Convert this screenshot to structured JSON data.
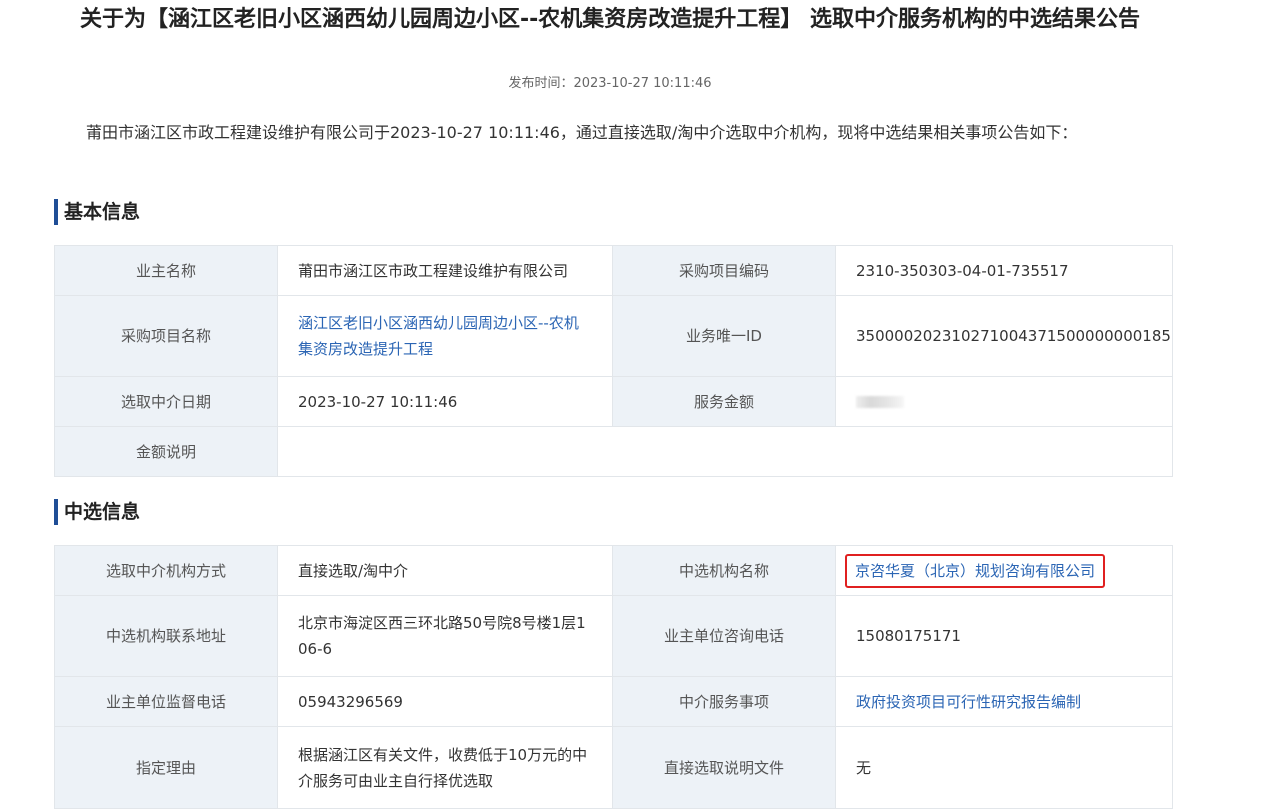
{
  "notice": {
    "title": "关于为【涵江区老旧小区涵西幼儿园周边小区--农机集资房改造提升工程】 选取中介服务机构的中选结果公告",
    "publish_time": "发布时间：2023-10-27 10:11:46",
    "intro": "莆田市涵江区市政工程建设维护有限公司于2023-10-27 10:11:46，通过直接选取/淘中介选取中介机构，现将中选结果相关事项公告如下："
  },
  "basic": {
    "heading": "基本信息",
    "owner_label": "业主名称",
    "owner_value": "莆田市涵江区市政工程建设维护有限公司",
    "proj_code_label": "采购项目编码",
    "proj_code_value": "2310-350303-04-01-735517",
    "proj_name_label": "采购项目名称",
    "proj_name_value": "涵江区老旧小区涵西幼儿园周边小区--农机集资房改造提升工程",
    "biz_id_label": "业务唯一ID",
    "biz_id_value": "350000202310271004371500000000185",
    "date_label": "选取中介日期",
    "date_value": "2023-10-27 10:11:46",
    "amount_label": "服务金额",
    "amount_note_label": "金额说明",
    "amount_note_value": ""
  },
  "selected": {
    "heading": "中选信息",
    "method_label": "选取中介机构方式",
    "method_value": "直接选取/淘中介",
    "org_label": "中选机构名称",
    "org_value": "京咨华夏（北京）规划咨询有限公司",
    "addr_label": "中选机构联系地址",
    "addr_value": "北京市海淀区西三环北路50号院8号楼1层106-6",
    "consult_phone_label": "业主单位咨询电话",
    "consult_phone_value": "15080175171",
    "supervise_phone_label": "业主单位监督电话",
    "supervise_phone_value": "05943296569",
    "service_label": "中介服务事项",
    "service_value": "政府投资项目可行性研究报告编制",
    "reason_label": "指定理由",
    "reason_value": "根据涵江区有关文件，收费低于10万元的中介服务可由业主自行择优选取",
    "direct_doc_label": "直接选取说明文件",
    "direct_doc_value": "无"
  }
}
